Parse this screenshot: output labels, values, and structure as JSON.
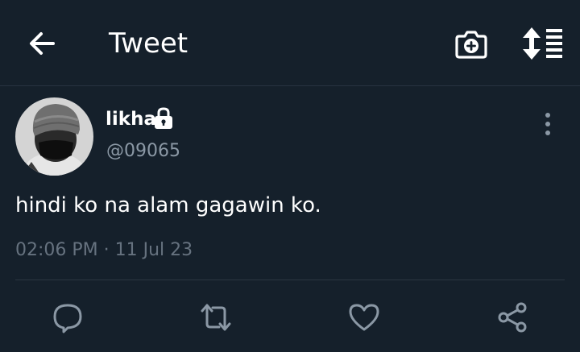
{
  "header": {
    "title": "Tweet",
    "back_icon": "arrow-left-icon",
    "camera_icon": "camera-add-icon",
    "sort_icon": "sort-lines-icon"
  },
  "tweet": {
    "display_name": "likha",
    "protected_icon": "lock-icon",
    "handle": "@09065",
    "text": "hindi ko na alam gagawin ko.",
    "timestamp": "02:06 PM · 11 Jul 23",
    "more_icon": "more-vertical-icon"
  },
  "actions": [
    {
      "name": "reply",
      "icon": "reply-icon"
    },
    {
      "name": "retweet",
      "icon": "retweet-icon"
    },
    {
      "name": "like",
      "icon": "heart-icon"
    },
    {
      "name": "share",
      "icon": "share-icon"
    }
  ],
  "colors": {
    "background": "#15202b",
    "primary_text": "#ffffff",
    "secondary_text": "#8b98a5",
    "timestamp_text": "#66727f",
    "icon": "#8b98a5",
    "divider": "#2b3641"
  }
}
